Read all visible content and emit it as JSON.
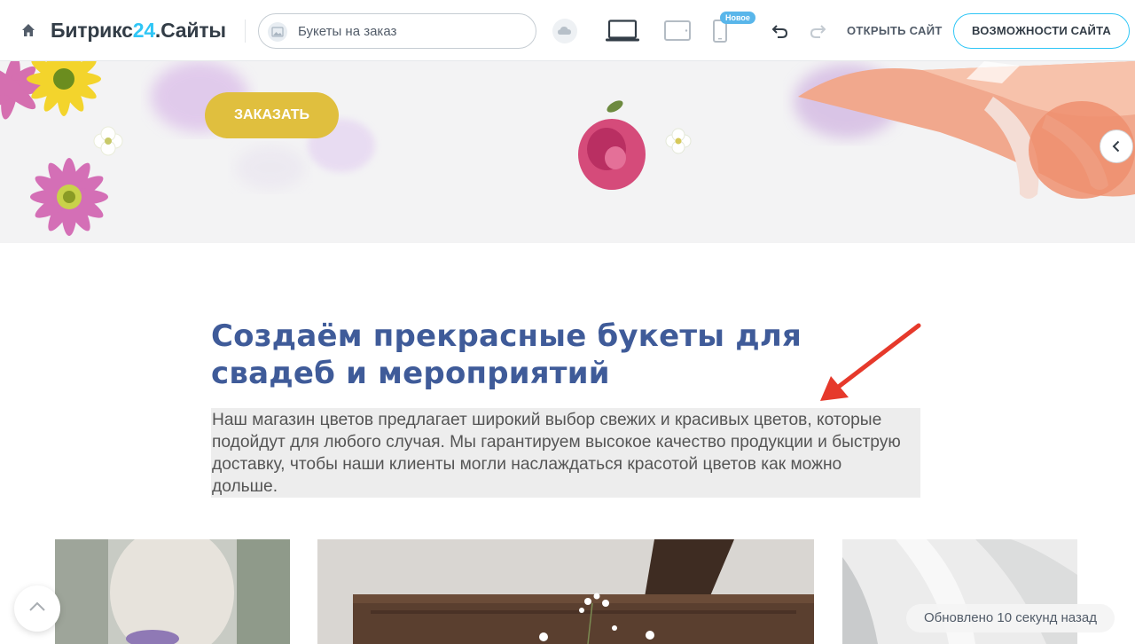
{
  "toolbar": {
    "logo_main": "Битрикс",
    "logo_num": "24",
    "logo_suffix": ".Сайты",
    "site_name": "Букеты на заказ",
    "new_badge": "Новое",
    "open_site": "ОТКРЫТЬ САЙТ",
    "features": "ВОЗМОЖНОСТИ САЙТА",
    "devices": [
      "laptop-icon",
      "tablet-icon",
      "phone-icon"
    ],
    "active_device": "laptop"
  },
  "hero": {
    "order_button": "ЗАКАЗАТЬ"
  },
  "intro": {
    "heading_line1": "Создаём прекрасные букеты для",
    "heading_line2": "свадеб и мероприятий",
    "text_line1": "Наш магазин цветов предлагает широкий выбор свежих и красивых цветов, которые",
    "text_line2": "подойдут для любого случая. Мы гарантируем высокое качество продукции и быструю",
    "text_line3": "доставку, чтобы наши клиенты могли наслаждаться красотой цветов как можно",
    "text_line4": "дольше."
  },
  "status": {
    "updated": "Обновлено 10 секунд назад"
  },
  "colors": {
    "accent": "#2fc6f6",
    "heading": "#3f5b99",
    "order_button": "#e0bf3e",
    "annotation_arrow": "#e6392b"
  }
}
